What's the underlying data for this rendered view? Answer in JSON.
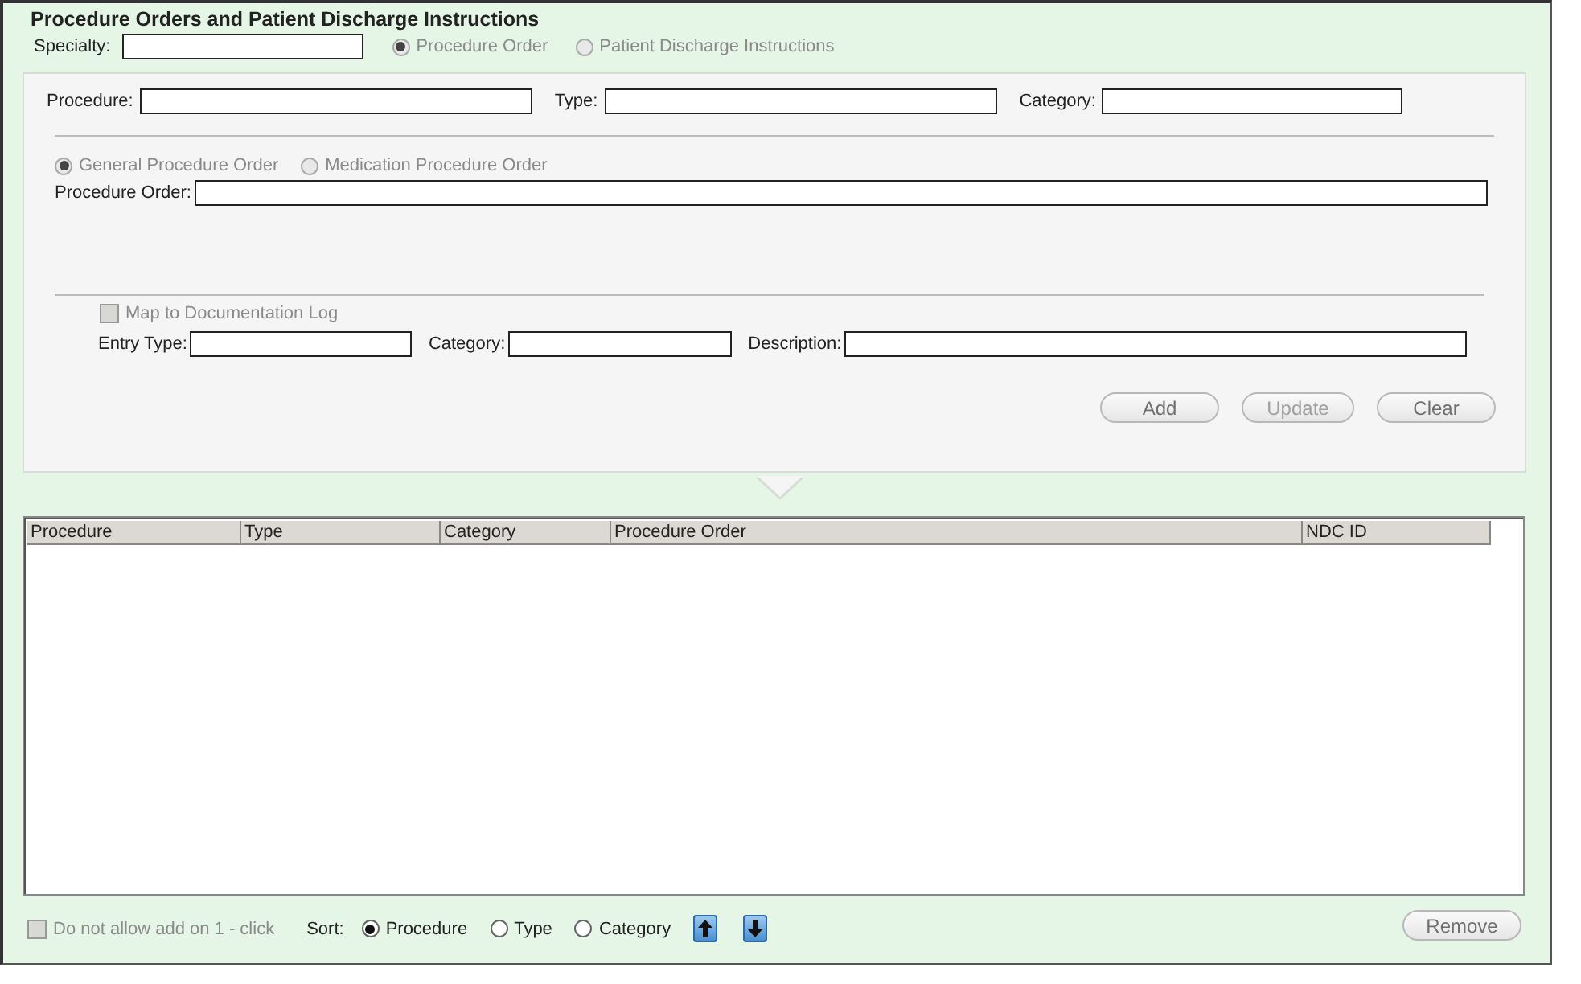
{
  "title": "Procedure Orders and Patient Discharge Instructions",
  "specialty": {
    "label": "Specialty:"
  },
  "mode_options": [
    {
      "label": "Procedure Order",
      "selected": true,
      "disabled": true
    },
    {
      "label": "Patient Discharge Instructions",
      "selected": false,
      "disabled": true
    }
  ],
  "fields_row": [
    {
      "label": "Procedure:"
    },
    {
      "label": "Type:"
    },
    {
      "label": "Category:"
    }
  ],
  "order_options": [
    {
      "label": "General Procedure Order",
      "selected": true,
      "disabled": true
    },
    {
      "label": "Medication Procedure Order",
      "selected": false,
      "disabled": true
    }
  ],
  "procedure_order": {
    "label": "Procedure Order:"
  },
  "map_checkbox": {
    "label": "Map to Documentation Log",
    "checked": false,
    "disabled": true
  },
  "log_fields": [
    {
      "label": "Entry Type:"
    },
    {
      "label": "Category:"
    },
    {
      "label": "Description:"
    }
  ],
  "buttons": [
    {
      "label": "Add",
      "disabled": false
    },
    {
      "label": "Update",
      "disabled": true
    },
    {
      "label": "Clear",
      "disabled": false
    }
  ],
  "table": {
    "columns": [
      "Procedure",
      "Type",
      "Category",
      "Procedure Order",
      "NDC ID"
    ]
  },
  "footer": {
    "one_click": {
      "label": "Do not allow add on 1 - click",
      "checked": false,
      "disabled": true
    },
    "sort_label": "Sort:",
    "sort_options": [
      {
        "label": "Procedure",
        "selected": true
      },
      {
        "label": "Type",
        "selected": false
      },
      {
        "label": "Category",
        "selected": false
      }
    ],
    "remove": {
      "label": "Remove",
      "disabled": false
    }
  }
}
